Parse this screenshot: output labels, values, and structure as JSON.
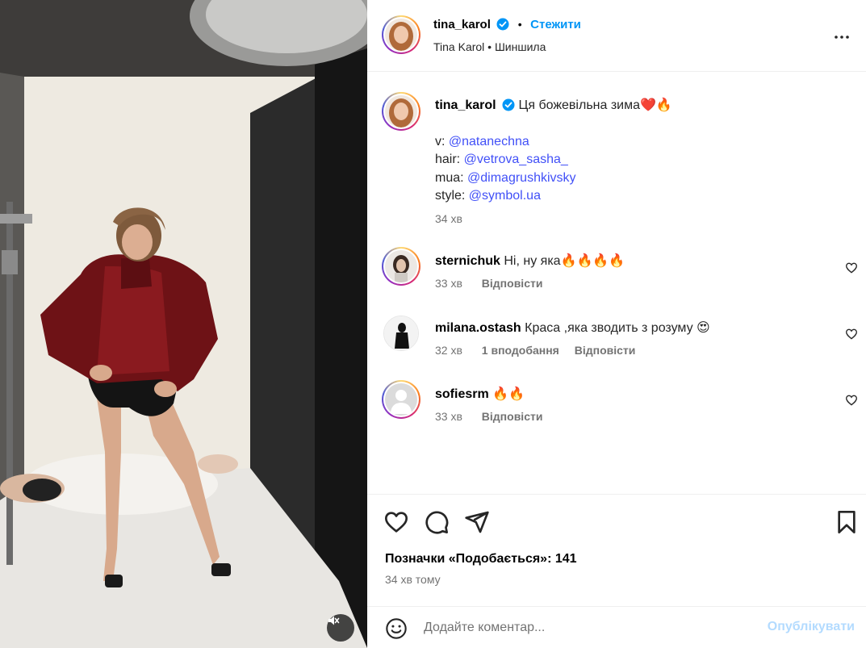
{
  "post": {
    "author": "tina_karol",
    "follow_label": "Стежити",
    "audio_line": "Tina Karol • Шиншила",
    "more_icon": "more-horizontal-icon"
  },
  "caption": {
    "username": "tina_karol",
    "text": "Ця божевільна зима❤️🔥",
    "credits": [
      {
        "prefix": "v: ",
        "handle": "@natanechna"
      },
      {
        "prefix": "hair: ",
        "handle": "@vetrova_sasha_"
      },
      {
        "prefix": "mua: ",
        "handle": "@dimagrushkivsky"
      },
      {
        "prefix": "style: ",
        "handle": "@symbol.ua"
      }
    ],
    "time": "34 хв"
  },
  "comments": [
    {
      "username": "sternichuk",
      "text": "Ні, ну яка🔥🔥🔥🔥",
      "time": "33 хв",
      "likes": "",
      "reply": "Відповісти"
    },
    {
      "username": "milana.ostash",
      "text": "Краса ,яка зводить з розуму 😍",
      "time": "32 хв",
      "likes": "1 вподобання",
      "reply": "Відповісти"
    },
    {
      "username": "sofiesrm",
      "text": "🔥🔥",
      "time": "33 хв",
      "likes": "",
      "reply": "Відповісти"
    }
  ],
  "actions": {
    "likes_text": "Позначки «Подобається»: 141",
    "ago": "34 хв тому"
  },
  "add_comment": {
    "placeholder": "Додайте коментар...",
    "publish_label": "Опублікувати"
  },
  "colors": {
    "link": "#4150f7",
    "follow": "#0095f6",
    "verified": "#0095f6",
    "publish_disabled": "#b3dbff",
    "jacket": "#6e1216"
  }
}
